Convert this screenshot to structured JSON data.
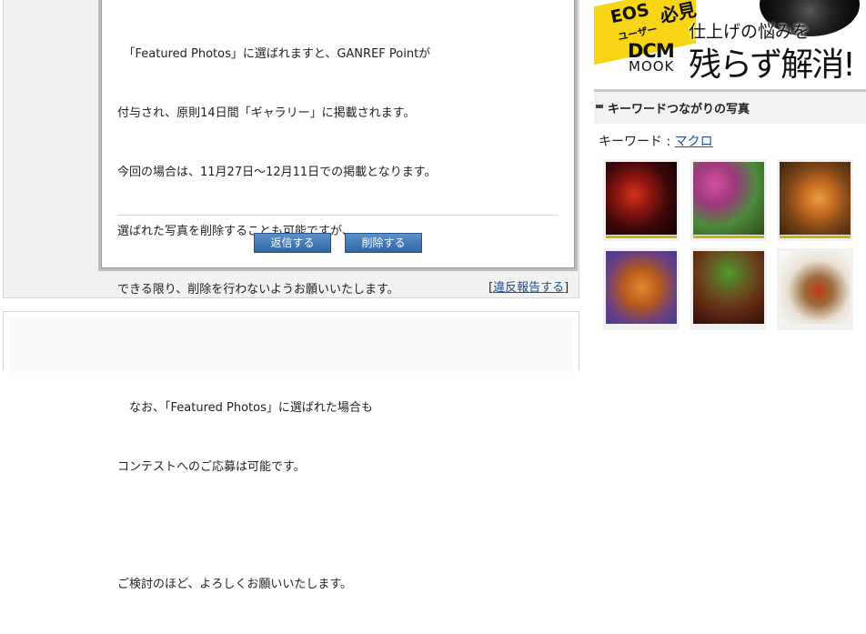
{
  "message": {
    "lines": [
      "　「Featured Photos」に選ばれますと、GANREF Pointが",
      "付与され、原則14日間「ギャラリー」に掲載されます。",
      "今回の場合は、11月27日～12月11日での掲載となります。",
      "選ばれた写真を削除することも可能ですが、",
      "できる限り、削除を行わないようお願いいたします。",
      "",
      "　なお、「Featured Photos」に選ばれた場合も",
      "コンテストへのご応募は可能です。",
      "",
      "ご検討のほど、よろしくお願いいたします。"
    ],
    "reply_label": "返信する",
    "delete_label": "削除する"
  },
  "report": {
    "bracket_open": "[",
    "link_label": "違反報告する",
    "bracket_close": "]"
  },
  "ad": {
    "eos": "EOS",
    "user": "ユーザー",
    "hikken": "必見",
    "dcm": "DCM",
    "mook": "MOOK",
    "sub": "仕上げの悩みを",
    "main": "残らず解消!"
  },
  "sidebar": {
    "title": "キーワードつながりの写真",
    "keyword_label": "キーワード : ",
    "keyword_value": "マクロ",
    "thumbnails": [
      {
        "alt": "red leaves"
      },
      {
        "alt": "pink flower bud"
      },
      {
        "alt": "autumn leaves"
      },
      {
        "alt": "orange leaves"
      },
      {
        "alt": "leaf on branch"
      },
      {
        "alt": "red bud"
      }
    ]
  },
  "colors": {
    "button": "#2f66a5",
    "link": "#1f4f8f",
    "accent_yellow": "#f7d415",
    "thumb_underline": "#c8b215"
  }
}
